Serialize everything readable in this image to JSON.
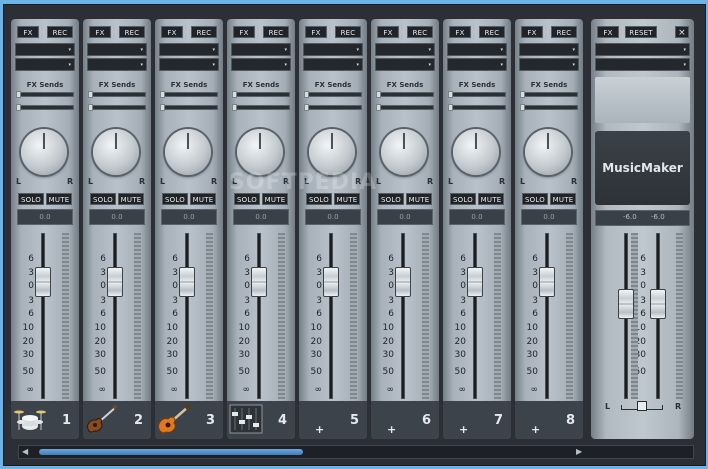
{
  "labels": {
    "fx": "FX",
    "rec": "REC",
    "reset": "RESET",
    "close": "×",
    "fx_sends": "FX Sends",
    "pan_left": "L",
    "pan_right": "R",
    "solo": "SOLO",
    "mute": "MUTE",
    "dropdown_arrow": "▾",
    "add": "+"
  },
  "scale_marks": [
    "6",
    "3",
    "0",
    "3",
    "6",
    "10",
    "20",
    "30",
    "50",
    "∞"
  ],
  "channels": [
    {
      "number": "1",
      "volume": "0.0",
      "icon": "drums-icon",
      "has_instrument": true
    },
    {
      "number": "2",
      "volume": "0.0",
      "icon": "electric-guitar-icon",
      "has_instrument": true
    },
    {
      "number": "3",
      "volume": "0.0",
      "icon": "acoustic-guitar-icon",
      "has_instrument": true
    },
    {
      "number": "4",
      "volume": "0.0",
      "icon": "mixer-icon",
      "has_instrument": true
    },
    {
      "number": "5",
      "volume": "0.0",
      "icon": "",
      "has_instrument": false
    },
    {
      "number": "6",
      "volume": "0.0",
      "icon": "",
      "has_instrument": false
    },
    {
      "number": "7",
      "volume": "0.0",
      "icon": "",
      "has_instrument": false
    },
    {
      "number": "8",
      "volume": "0.0",
      "icon": "",
      "has_instrument": false
    }
  ],
  "master": {
    "brand": "MusicMaker",
    "left_db": "-6.0",
    "right_db": "-6.0",
    "left_label": "L",
    "right_label": "R",
    "lock_icon": "lock-icon"
  },
  "watermark": "SOFTPEDIA",
  "scrollbar": {
    "left_arrow": "◀",
    "right_arrow": "▶",
    "position_fraction": 0.0
  }
}
